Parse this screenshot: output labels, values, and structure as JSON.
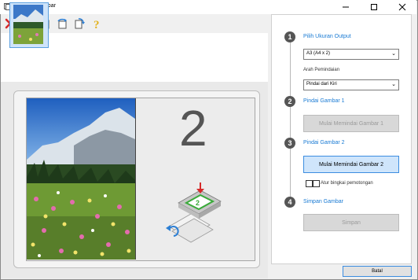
{
  "window": {
    "title": "Rangkai Gambar"
  },
  "toolbar": {
    "icons": [
      "delete-icon",
      "zoom-icon",
      "rotate-left-icon",
      "rotate-180-icon",
      "rotate-right-icon",
      "help-icon"
    ]
  },
  "preview": {
    "page_number": "2"
  },
  "steps": [
    {
      "number": "1",
      "title": "Pilih Ukuran Output"
    },
    {
      "number": "2",
      "title": "Pindai Gambar 1"
    },
    {
      "number": "3",
      "title": "Pindai Gambar 2"
    },
    {
      "number": "4",
      "title": "Simpan Gambar"
    }
  ],
  "output_size": {
    "value": "A3 (A4 x 2)"
  },
  "scan_direction": {
    "label": "Arah Pemindaian",
    "value": "Pindai dari Kiri"
  },
  "buttons": {
    "scan1": "Mulai Memindai Gambar 1",
    "scan2": "Mulai Memindai Gambar 2",
    "save": "Simpan",
    "cancel": "Batal"
  },
  "crop_frame": {
    "label": "Atur bingkai pemotongan",
    "checked": false
  },
  "colors": {
    "accent": "#1a7bd4",
    "active_button": "#cfe5fb",
    "red_x": "#d62a2a"
  }
}
